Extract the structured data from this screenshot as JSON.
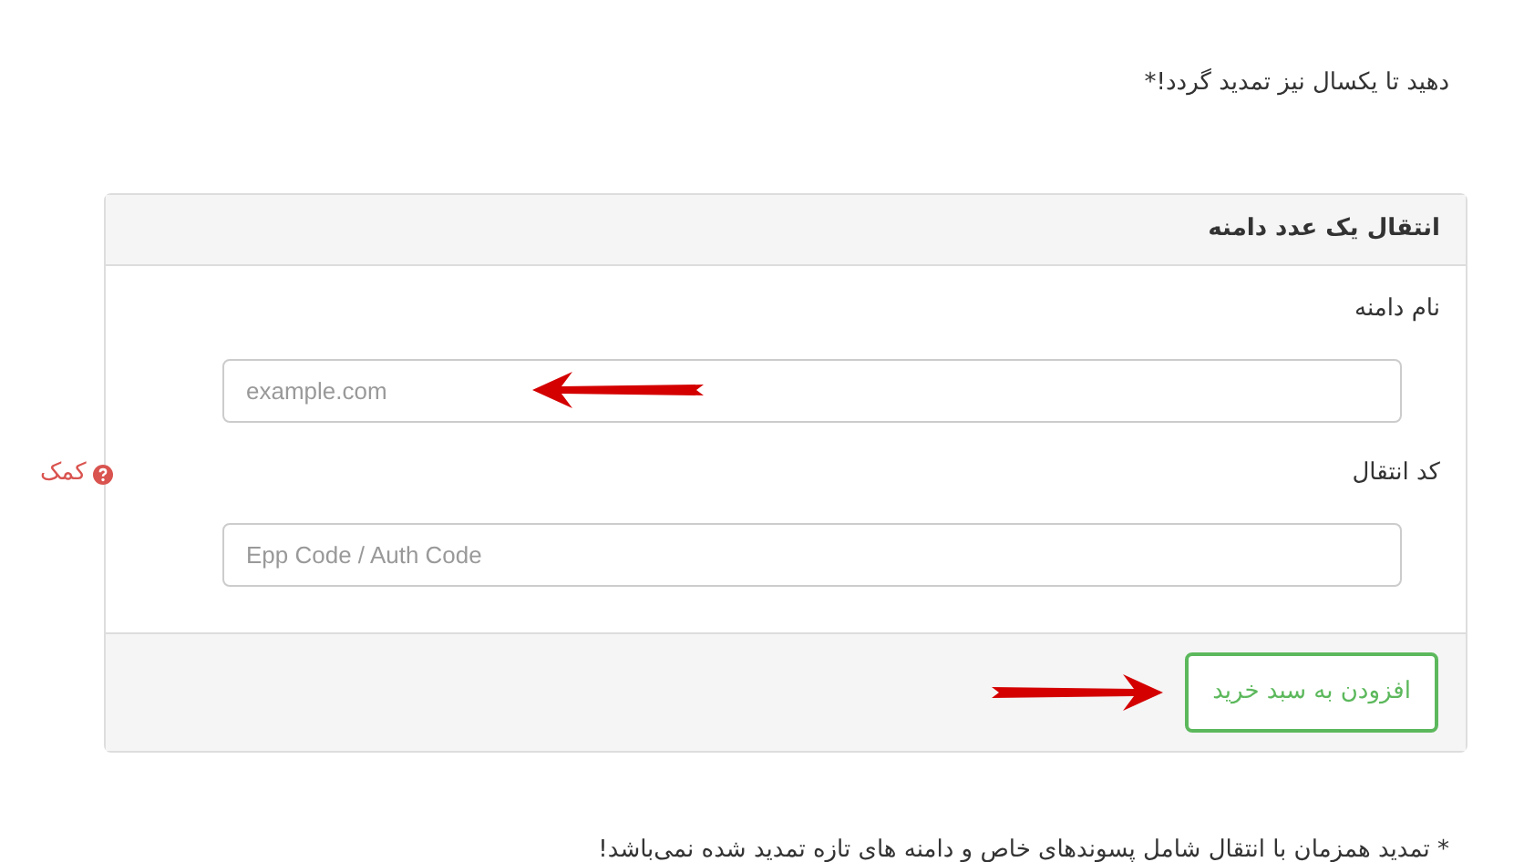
{
  "top_note": "دهید تا یکسال نیز تمدید گردد!*",
  "panel": {
    "title": "انتقال یک عدد دامنه",
    "fields": [
      {
        "label": "نام دامنه",
        "placeholder": "example.com"
      },
      {
        "label": "کد انتقال",
        "placeholder": "Epp Code / Auth Code",
        "help": "کمک"
      }
    ],
    "submit": "افزودن به سبد خرید"
  },
  "footnote": "* تمدید همزمان با انتقال شامل پسوندهای خاص و دامنه های تازه تمدید شده نمی‌باشد!"
}
